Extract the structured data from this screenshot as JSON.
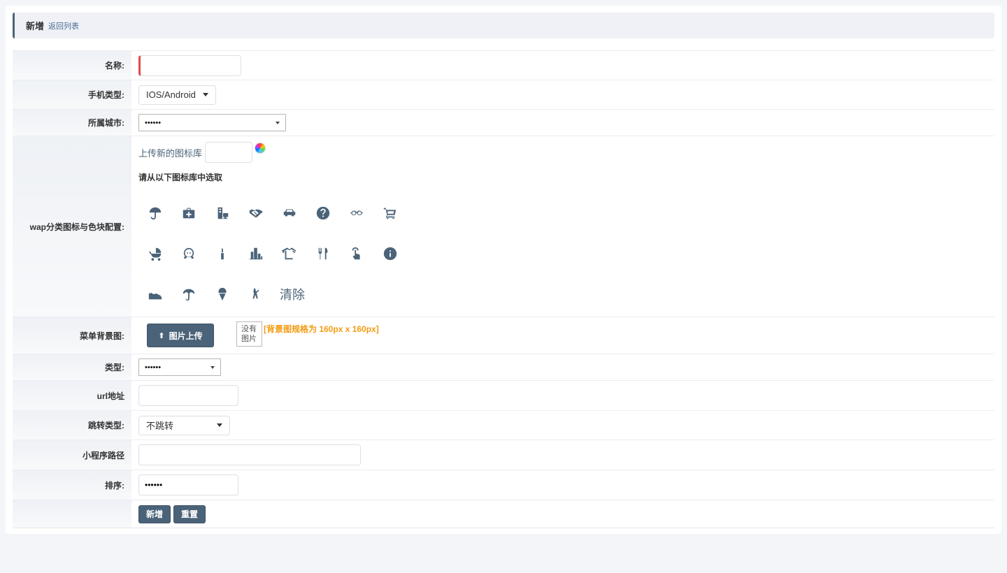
{
  "header": {
    "title": "新增",
    "back_link": "返回列表"
  },
  "form": {
    "name": {
      "label": "名称:",
      "value": ""
    },
    "phone_type": {
      "label": "手机类型:",
      "selected": "IOS/Android"
    },
    "city": {
      "label": "所属城市:",
      "selected": "••••••"
    },
    "wap_icon": {
      "label": "wap分类图标与色块配置:",
      "upload_lib": "上传新的图标库",
      "pick_title": "请从以下图标库中选取",
      "icon_rows": [
        [
          "umbrella-icon",
          "medkit-icon",
          "devices-icon",
          "handshake-icon",
          "car-icon",
          "question-circle-icon",
          "glasses-icon",
          "shopping-cart-icon"
        ],
        [
          "stroller-icon",
          "child-face-icon",
          "lipstick-icon",
          "buildings-icon",
          "tshirt-icon",
          "cutlery-icon",
          "touch-icon",
          "info-circle-icon"
        ],
        [
          "sneaker-icon",
          "parasol-icon",
          "ice-cream-icon",
          "fishing-icon"
        ]
      ],
      "clear": "清除"
    },
    "menu_bg": {
      "label": "菜单背景图:",
      "upload_button": "图片上传",
      "no_image": "没有图片",
      "hint": "[背景图规格为 160px x 160px]"
    },
    "type": {
      "label": "类型:",
      "selected": "••••••"
    },
    "url": {
      "label": "url地址",
      "value": ""
    },
    "jump_type": {
      "label": "跳转类型:",
      "selected": "不跳转"
    },
    "mini_path": {
      "label": "小程序路径",
      "value": ""
    },
    "sort": {
      "label": "排序:",
      "value": "••••••"
    },
    "actions": {
      "submit": "新增",
      "reset": "重置"
    }
  },
  "colors": {
    "primary": "#4b6378",
    "required": "#e04b4b",
    "hint": "#f39c12"
  }
}
